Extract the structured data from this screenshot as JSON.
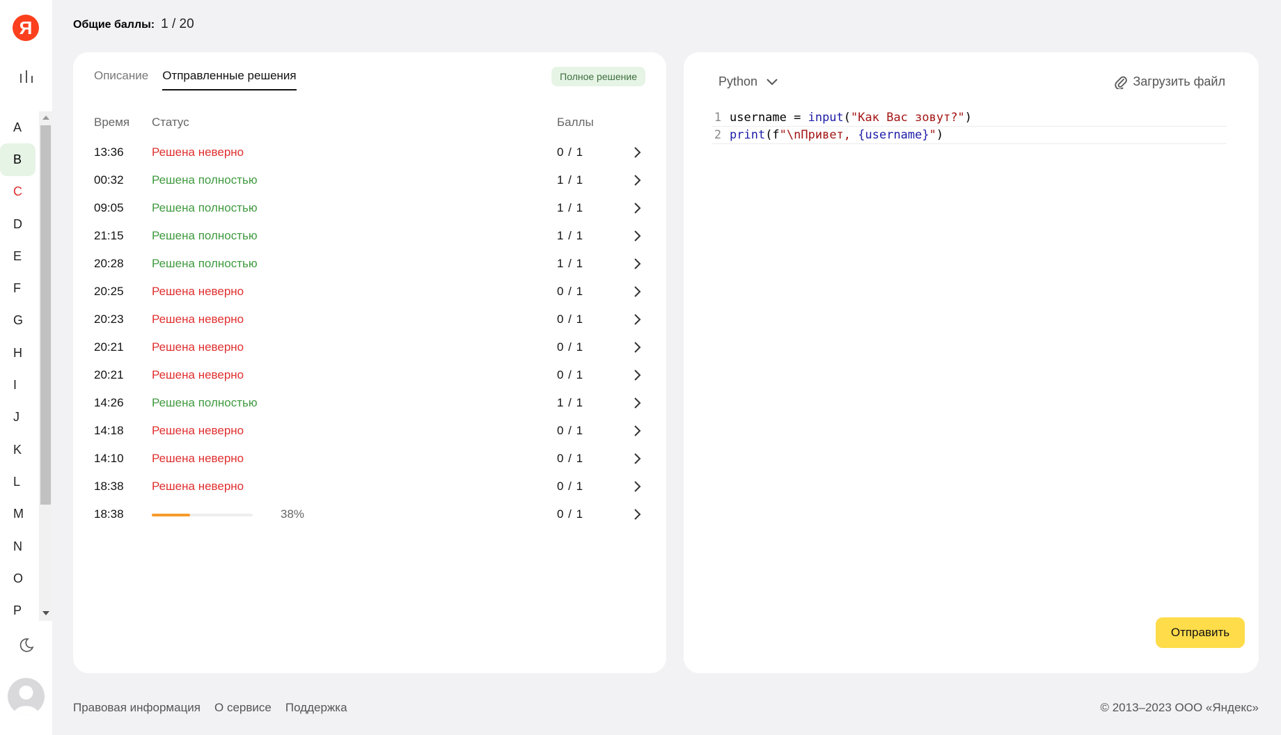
{
  "header": {
    "total_label": "Общие баллы:",
    "total_value": "1 / 20"
  },
  "sidebar": {
    "logo_text": "Я",
    "letters": [
      {
        "label": "A"
      },
      {
        "label": "B"
      },
      {
        "label": "C"
      },
      {
        "label": "D"
      },
      {
        "label": "E"
      },
      {
        "label": "F"
      },
      {
        "label": "G"
      },
      {
        "label": "H"
      },
      {
        "label": "I"
      },
      {
        "label": "J"
      },
      {
        "label": "K"
      },
      {
        "label": "L"
      },
      {
        "label": "M"
      },
      {
        "label": "N"
      },
      {
        "label": "O"
      },
      {
        "label": "P"
      }
    ],
    "active_letter": "B",
    "highlighted_letter": "C"
  },
  "left_panel": {
    "tabs": [
      {
        "label": "Описание"
      },
      {
        "label": "Отправленные решения"
      }
    ],
    "active_tab": "Отправленные решения",
    "badge": "Полное решение",
    "columns": {
      "time": "Время",
      "status": "Статус",
      "score": "Баллы"
    },
    "rows": [
      {
        "time": "13:36",
        "status": "Решена неверно",
        "state": "bad",
        "score": "0 / 1"
      },
      {
        "time": "00:32",
        "status": "Решена полностью",
        "state": "good",
        "score": "1 / 1"
      },
      {
        "time": "09:05",
        "status": "Решена полностью",
        "state": "good",
        "score": "1 / 1"
      },
      {
        "time": "21:15",
        "status": "Решена полностью",
        "state": "good",
        "score": "1 / 1"
      },
      {
        "time": "20:28",
        "status": "Решена полностью",
        "state": "good",
        "score": "1 / 1"
      },
      {
        "time": "20:25",
        "status": "Решена неверно",
        "state": "bad",
        "score": "0 / 1"
      },
      {
        "time": "20:23",
        "status": "Решена неверно",
        "state": "bad",
        "score": "0 / 1"
      },
      {
        "time": "20:21",
        "status": "Решена неверно",
        "state": "bad",
        "score": "0 / 1"
      },
      {
        "time": "20:21",
        "status": "Решена неверно",
        "state": "bad",
        "score": "0 / 1"
      },
      {
        "time": "14:26",
        "status": "Решена полностью",
        "state": "good",
        "score": "1 / 1"
      },
      {
        "time": "14:18",
        "status": "Решена неверно",
        "state": "bad",
        "score": "0 / 1"
      },
      {
        "time": "14:10",
        "status": "Решена неверно",
        "state": "bad",
        "score": "0 / 1"
      },
      {
        "time": "18:38",
        "status": "Решена неверно",
        "state": "bad",
        "score": "0 / 1"
      },
      {
        "time": "18:38",
        "status": "",
        "state": "progress",
        "progress": 38,
        "progress_text": "38%",
        "score": "0 / 1"
      }
    ]
  },
  "editor": {
    "language": "Python",
    "upload_label": "Загрузить файл",
    "lines": [
      {
        "num": "1",
        "parts": [
          {
            "t": "username = ",
            "c": ""
          },
          {
            "t": "input",
            "c": "kw"
          },
          {
            "t": "(",
            "c": ""
          },
          {
            "t": "\"Как Вас зовут?\"",
            "c": "str"
          },
          {
            "t": ")",
            "c": ""
          }
        ]
      },
      {
        "num": "2",
        "parts": [
          {
            "t": "print",
            "c": "kw"
          },
          {
            "t": "(f",
            "c": ""
          },
          {
            "t": "\"\\nПривет, ",
            "c": "str"
          },
          {
            "t": "{username}",
            "c": "kw"
          },
          {
            "t": "\"",
            "c": "str"
          },
          {
            "t": ")",
            "c": ""
          }
        ]
      }
    ],
    "submit_label": "Отправить"
  },
  "footer": {
    "links": [
      {
        "label": "Правовая информация"
      },
      {
        "label": "О сервисе"
      },
      {
        "label": "Поддержка"
      }
    ],
    "copyright": "© 2013–2023 ООО «Яндекс»"
  },
  "colors": {
    "bad": "#e02f2f",
    "good": "#3f9a3f",
    "progress": "#f59b2b",
    "submit": "#fedc4a",
    "logo": "#fc3f1d"
  }
}
